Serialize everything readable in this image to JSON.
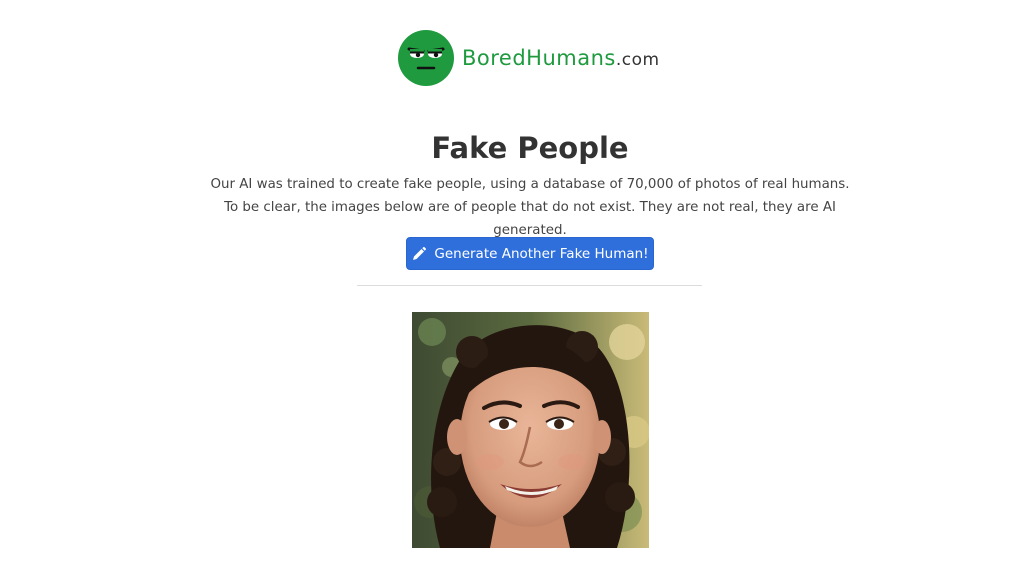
{
  "logo": {
    "brand": "BoredHumans",
    "tld": ".com",
    "brand_color": "#1f9a3f"
  },
  "header": {
    "title": "Fake People",
    "description": "Our AI was trained to create fake people, using a database of 70,000 of photos of real humans. To be clear, the images below are of people that do not exist. They are not real, they are AI generated."
  },
  "actions": {
    "generate_label": "Generate Another Fake Human!",
    "generate_icon": "pencil-icon",
    "button_color": "#2f6fdc"
  },
  "photo": {
    "alt": "AI generated face"
  }
}
